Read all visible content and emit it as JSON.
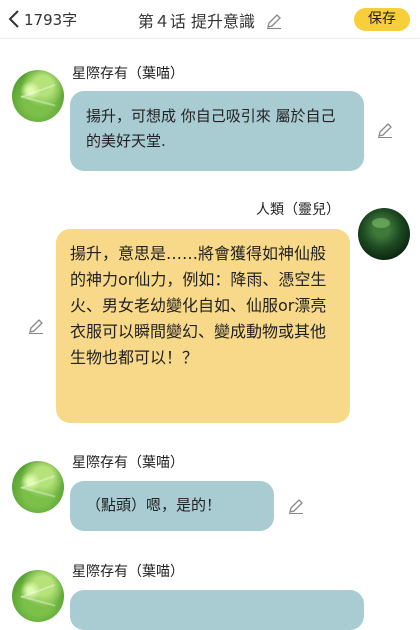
{
  "header": {
    "back_label": "1793字",
    "title": "第４话 提升意識",
    "save_label": "保存"
  },
  "messages": [
    {
      "sender": "星際存有（葉喵）",
      "text": "揚升，可想成 你自己吸引來 屬於自己的美好天堂.",
      "side": "left"
    },
    {
      "sender": "人類（靈兒）",
      "text": "揚升，意思是……將會獲得如神仙般的神力or仙力，例如：降雨、憑空生火、男女老幼變化自如、仙服or漂亮衣服可以瞬間變幻、變成動物或其他生物也都可以！？",
      "side": "right"
    },
    {
      "sender": "星際存有（葉喵）",
      "text": "（點頭）嗯，是的！",
      "side": "left"
    },
    {
      "sender": "星際存有（葉喵）",
      "text": "",
      "side": "left"
    }
  ],
  "colors": {
    "save_button": "#f6cf3a",
    "bubble_left": "#a9cbd2",
    "bubble_right": "#f8d98a"
  },
  "icons": [
    "chevron-left-icon",
    "pencil-icon",
    "avatar-green-leaf",
    "avatar-dark-sphere"
  ]
}
